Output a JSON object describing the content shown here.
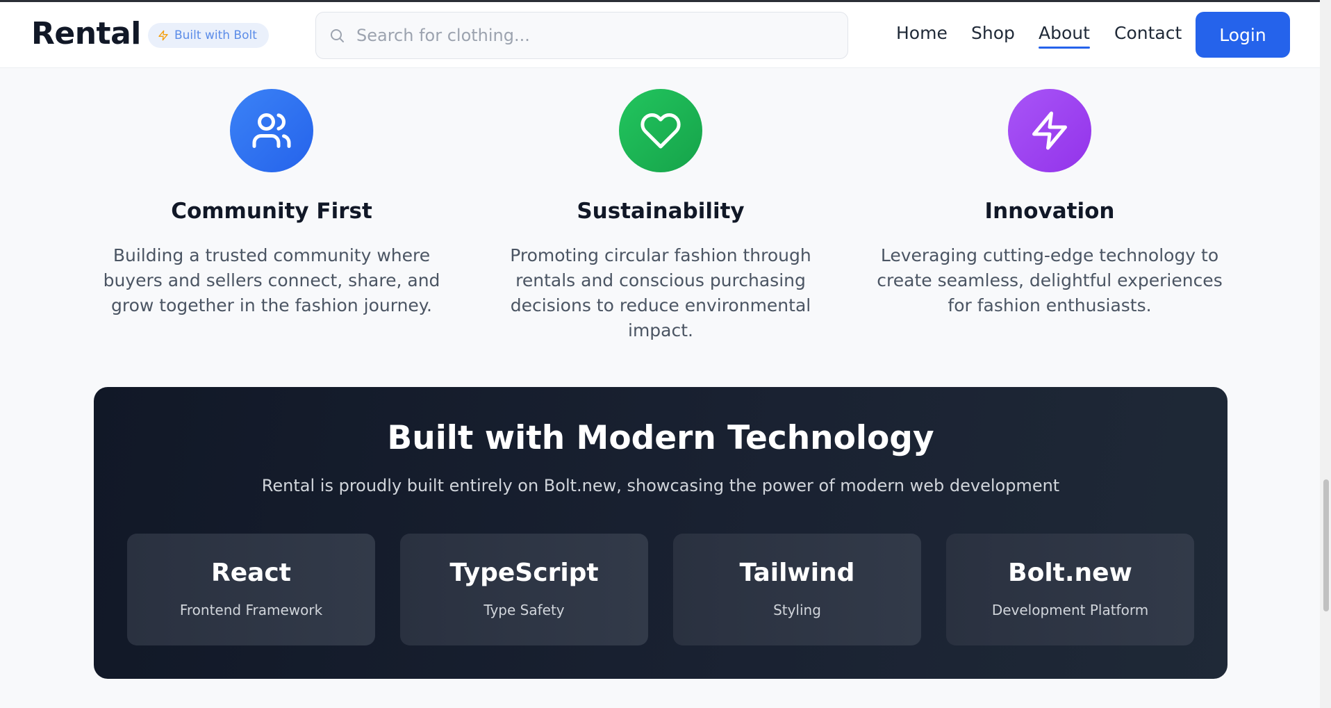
{
  "header": {
    "brand": "Rental",
    "badge": "Built with Bolt",
    "search_placeholder": "Search for clothing...",
    "nav": [
      "Home",
      "Shop",
      "About",
      "Contact"
    ],
    "active_nav": "About",
    "login_label": "Login"
  },
  "values": [
    {
      "icon": "users-icon",
      "color": "#2563eb",
      "title": "Community First",
      "description": "Building a trusted community where buyers and sellers connect, share, and grow together in the fashion journey."
    },
    {
      "icon": "heart-icon",
      "color": "#16a34a",
      "title": "Sustainability",
      "description": "Promoting circular fashion through rentals and conscious purchasing decisions to reduce environmental impact."
    },
    {
      "icon": "zap-icon",
      "color": "#9333ea",
      "title": "Innovation",
      "description": "Leveraging cutting-edge technology to create seamless, delightful experiences for fashion enthusiasts."
    }
  ],
  "tech": {
    "title": "Built with Modern Technology",
    "subtitle": "Rental is proudly built entirely on Bolt.new, showcasing the power of modern web development",
    "items": [
      {
        "name": "React",
        "desc": "Frontend Framework"
      },
      {
        "name": "TypeScript",
        "desc": "Type Safety"
      },
      {
        "name": "Tailwind",
        "desc": "Styling"
      },
      {
        "name": "Bolt.new",
        "desc": "Development Platform"
      }
    ]
  },
  "colors": {
    "accent": "#2563eb",
    "tech_bg": "#111827"
  }
}
